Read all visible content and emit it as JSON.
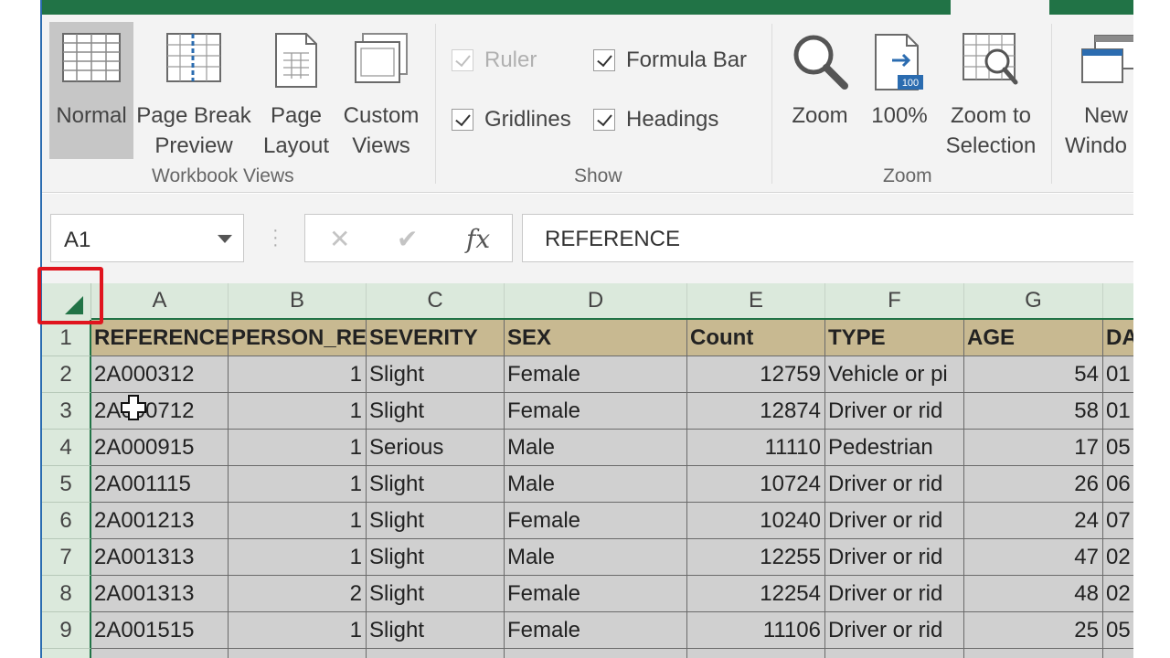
{
  "ribbon": {
    "workbook_views": {
      "group_label": "Workbook Views",
      "normal": "Normal",
      "page_break_1": "Page Break",
      "page_break_2": "Preview",
      "page_layout_1": "Page",
      "page_layout_2": "Layout",
      "custom_views_1": "Custom",
      "custom_views_2": "Views"
    },
    "show": {
      "group_label": "Show",
      "ruler": "Ruler",
      "ruler_checked": true,
      "ruler_enabled": false,
      "formula_bar": "Formula Bar",
      "formula_bar_checked": true,
      "gridlines": "Gridlines",
      "gridlines_checked": true,
      "headings": "Headings",
      "headings_checked": true
    },
    "zoom": {
      "group_label": "Zoom",
      "zoom": "Zoom",
      "hundred": "100%",
      "hundred_badge": "100",
      "zoom_selection_1": "Zoom to",
      "zoom_selection_2": "Selection"
    },
    "window": {
      "new_window_1": "New",
      "new_window_2": "Windo"
    }
  },
  "formula_bar": {
    "name_box": "A1",
    "cancel": "✕",
    "enter": "✔",
    "fx": "fx",
    "content": "REFERENCE"
  },
  "grid": {
    "columns": [
      "A",
      "B",
      "C",
      "D",
      "E",
      "F",
      "G",
      ""
    ],
    "rows": [
      {
        "num": "1",
        "cells": [
          "REFERENCE",
          "PERSON_RE",
          "SEVERITY",
          "SEX",
          "Count",
          "TYPE",
          "AGE",
          "DA"
        ]
      },
      {
        "num": "2",
        "cells": [
          "2A000312",
          "1",
          "Slight",
          "Female",
          "12759",
          "Vehicle or pi",
          "54",
          "01"
        ]
      },
      {
        "num": "3",
        "cells": [
          "2A000712",
          "1",
          "Slight",
          "Female",
          "12874",
          "Driver or rid",
          "58",
          "01"
        ]
      },
      {
        "num": "4",
        "cells": [
          "2A000915",
          "1",
          "Serious",
          "Male",
          "11110",
          "Pedestrian",
          "17",
          "05"
        ]
      },
      {
        "num": "5",
        "cells": [
          "2A001115",
          "1",
          "Slight",
          "Male",
          "10724",
          "Driver or rid",
          "26",
          "06"
        ]
      },
      {
        "num": "6",
        "cells": [
          "2A001213",
          "1",
          "Slight",
          "Female",
          "10240",
          "Driver or rid",
          "24",
          "07"
        ]
      },
      {
        "num": "7",
        "cells": [
          "2A001313",
          "1",
          "Slight",
          "Male",
          "12255",
          "Driver or rid",
          "47",
          "02"
        ]
      },
      {
        "num": "8",
        "cells": [
          "2A001313",
          "2",
          "Slight",
          "Female",
          "12254",
          "Driver or rid",
          "48",
          "02"
        ]
      },
      {
        "num": "9",
        "cells": [
          "2A001515",
          "1",
          "Slight",
          "Female",
          "11106",
          "Driver or rid",
          "25",
          "05"
        ]
      }
    ]
  },
  "colors": {
    "excel_green": "#217346",
    "header_fill": "#c8b991",
    "cell_fill": "#d0d0d0",
    "highlight_red": "#e0141e"
  }
}
